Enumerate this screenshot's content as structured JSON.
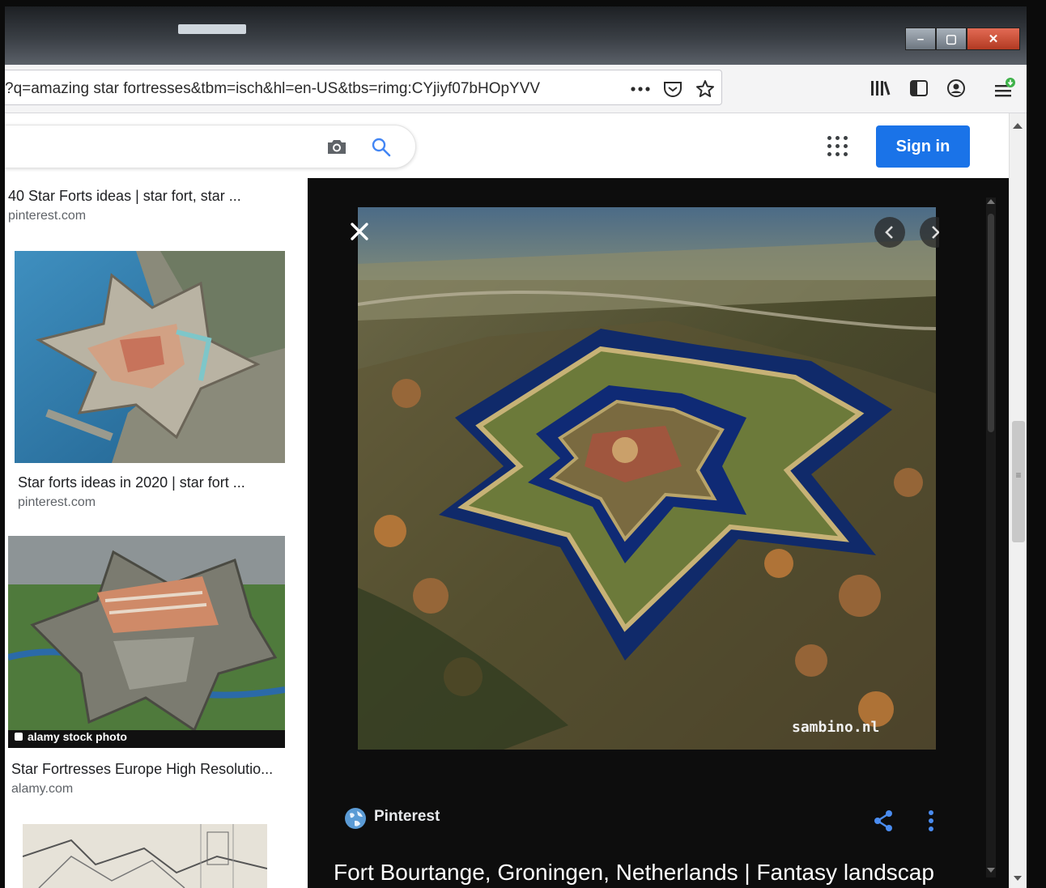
{
  "browser": {
    "url": "?q=amazing star fortresses&tbm=isch&hl=en-US&tbs=rimg:CYjiyf07bHOpYVV",
    "window_controls": {
      "minimize": "–",
      "maximize": "▢",
      "close": "✕"
    }
  },
  "google": {
    "sign_in_label": "Sign in"
  },
  "results": [
    {
      "title": "40 Star Forts ideas | star fort, star ...",
      "source": "pinterest.com"
    },
    {
      "title": "Star forts ideas in 2020 | star fort ...",
      "source": "pinterest.com"
    },
    {
      "title": "Star Fortresses Europe High Resolutio...",
      "source": "alamy.com",
      "watermark": "alamy stock photo"
    }
  ],
  "viewer": {
    "source": "Pinterest",
    "title": "Fort Bourtange, Groningen, Netherlands | Fantasy landscap",
    "watermark": "sambino.nl"
  }
}
